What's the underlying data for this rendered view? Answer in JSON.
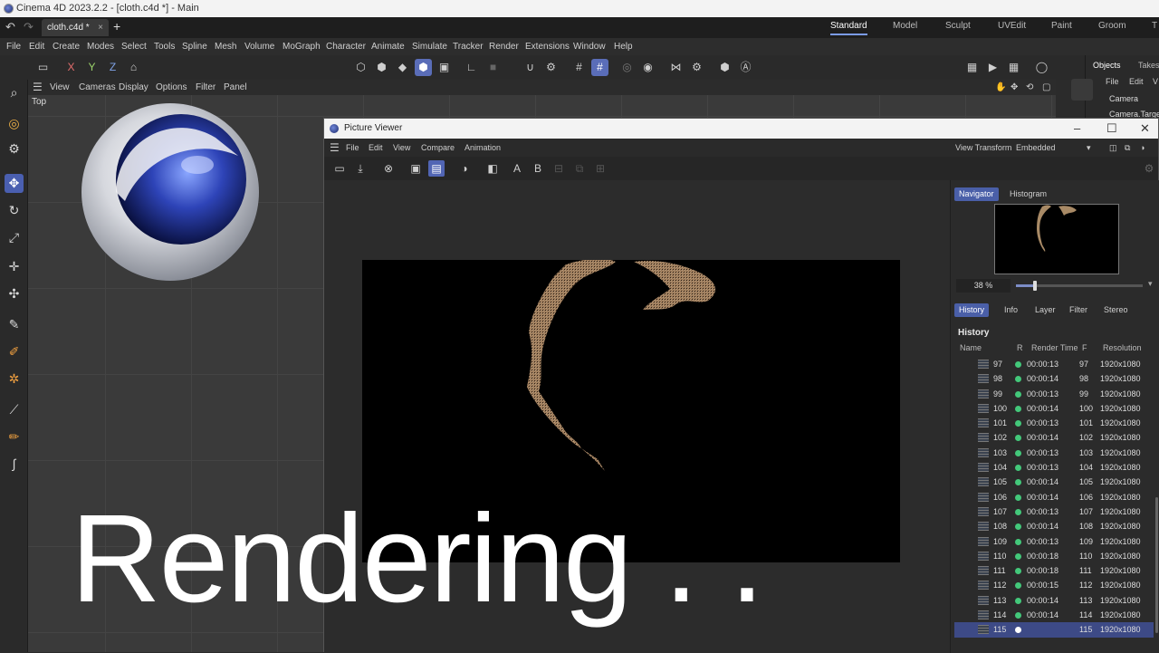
{
  "window": {
    "title": "Cinema 4D 2023.2.2 - [cloth.c4d *] - Main"
  },
  "tabs": {
    "doc": "cloth.c4d *",
    "close": "×",
    "add": "+"
  },
  "layouts": [
    "Standard",
    "Model",
    "Sculpt",
    "UVEdit",
    "Paint",
    "Groom",
    "T"
  ],
  "menu": [
    "File",
    "Edit",
    "Create",
    "Modes",
    "Select",
    "Tools",
    "Spline",
    "Mesh",
    "Volume",
    "MoGraph",
    "Character",
    "Animate",
    "Simulate",
    "Tracker",
    "Render",
    "Extensions",
    "Window",
    "Help"
  ],
  "axes": {
    "x": "X",
    "y": "Y",
    "z": "Z"
  },
  "viewport": {
    "menu": [
      "View",
      "Cameras",
      "Display",
      "Options",
      "Filter",
      "Panel"
    ],
    "label": "Top"
  },
  "objects_panel": {
    "tabs": [
      "Objects",
      "Takes"
    ],
    "menu": [
      "File",
      "Edit",
      "V"
    ],
    "items": [
      "Camera",
      "Camera.Targe"
    ]
  },
  "picture_viewer": {
    "title": "Picture Viewer",
    "menu": [
      "File",
      "Edit",
      "View",
      "Compare",
      "Animation"
    ],
    "view_transform_label": "View Transform",
    "view_transform_value": "Embedded",
    "compare_a": "A",
    "compare_b": "B",
    "side_tabs": [
      "Navigator",
      "Histogram"
    ],
    "zoom": "38 %",
    "zoom_fraction": 0.15,
    "info_tabs": [
      "History",
      "Info",
      "Layer",
      "Filter",
      "Stereo"
    ],
    "history_title": "History",
    "history_columns": [
      "Name",
      "R",
      "Render Time",
      "F",
      "Resolution"
    ],
    "history_rows": [
      {
        "name": "97",
        "time": "00:00:13",
        "frame": "97",
        "res": "1920x1080"
      },
      {
        "name": "98",
        "time": "00:00:14",
        "frame": "98",
        "res": "1920x1080"
      },
      {
        "name": "99",
        "time": "00:00:13",
        "frame": "99",
        "res": "1920x1080"
      },
      {
        "name": "100",
        "time": "00:00:14",
        "frame": "100",
        "res": "1920x1080"
      },
      {
        "name": "101",
        "time": "00:00:13",
        "frame": "101",
        "res": "1920x1080"
      },
      {
        "name": "102",
        "time": "00:00:14",
        "frame": "102",
        "res": "1920x1080"
      },
      {
        "name": "103",
        "time": "00:00:13",
        "frame": "103",
        "res": "1920x1080"
      },
      {
        "name": "104",
        "time": "00:00:13",
        "frame": "104",
        "res": "1920x1080"
      },
      {
        "name": "105",
        "time": "00:00:14",
        "frame": "105",
        "res": "1920x1080"
      },
      {
        "name": "106",
        "time": "00:00:14",
        "frame": "106",
        "res": "1920x1080"
      },
      {
        "name": "107",
        "time": "00:00:13",
        "frame": "107",
        "res": "1920x1080"
      },
      {
        "name": "108",
        "time": "00:00:14",
        "frame": "108",
        "res": "1920x1080"
      },
      {
        "name": "109",
        "time": "00:00:13",
        "frame": "109",
        "res": "1920x1080"
      },
      {
        "name": "110",
        "time": "00:00:18",
        "frame": "110",
        "res": "1920x1080"
      },
      {
        "name": "111",
        "time": "00:00:18",
        "frame": "111",
        "res": "1920x1080"
      },
      {
        "name": "112",
        "time": "00:00:15",
        "frame": "112",
        "res": "1920x1080"
      },
      {
        "name": "113",
        "time": "00:00:14",
        "frame": "113",
        "res": "1920x1080"
      },
      {
        "name": "114",
        "time": "00:00:14",
        "frame": "114",
        "res": "1920x1080"
      },
      {
        "name": "115",
        "time": "",
        "frame": "115",
        "res": "1920x1080",
        "selected": true
      }
    ]
  },
  "overlay_text": "Rendering . .",
  "colors": {
    "accent": "#5a6db8",
    "status_done": "#43c87a",
    "background": "#2b2b2b"
  }
}
